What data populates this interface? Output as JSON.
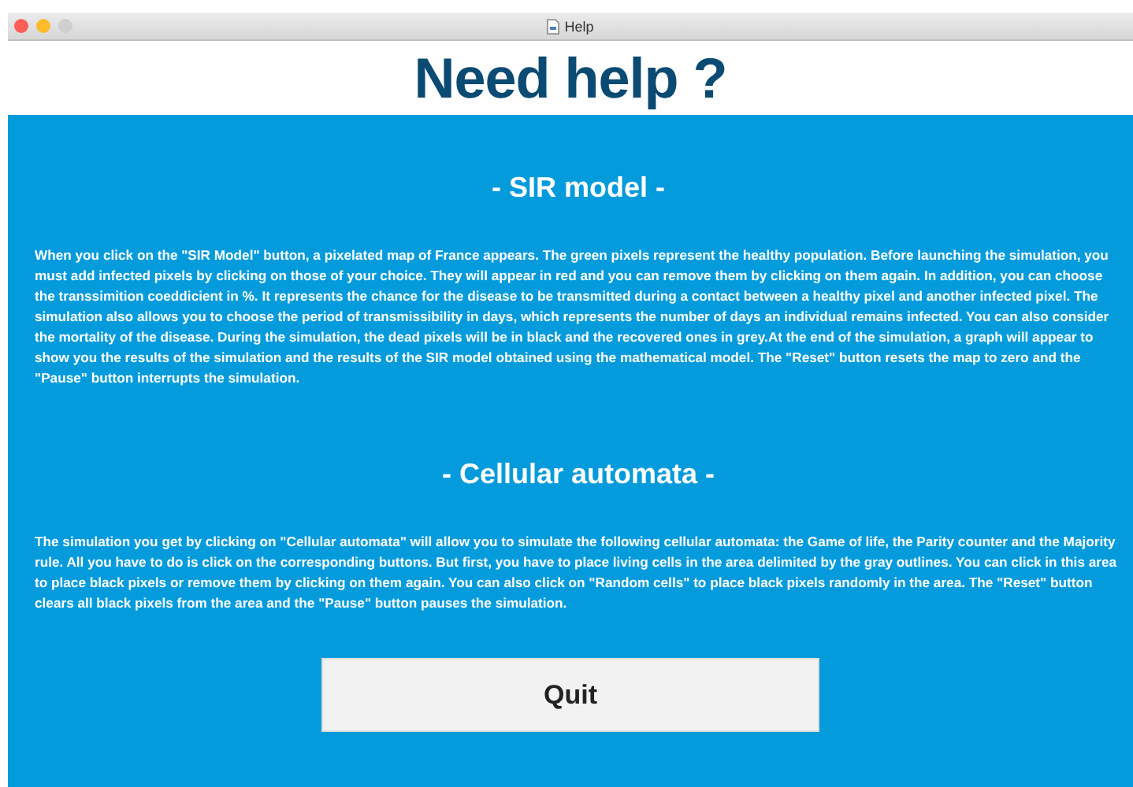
{
  "window": {
    "title": "Help"
  },
  "heading": "Need help ?",
  "sections": [
    {
      "title": "- SIR model -",
      "body": "When you click on the \"SIR Model\" button, a pixelated map of France appears. The green pixels represent the healthy population. Before launching the simulation, you must add infected pixels by clicking on those of your choice. They will appear in red and you can remove them by clicking on them again. In addition, you can choose the transsimition coeddicient in %. It represents the chance for the disease to be transmitted during a contact between a healthy pixel and another infected pixel. The simulation also allows you to choose the period of transmissibility in days, which represents the number of days an individual remains infected. You can also consider the mortality of the disease. During the simulation, the dead pixels will be in black and the recovered ones in grey.At the end of the simulation, a graph will appear to show you the results of the simulation and the results of the SIR model obtained using the mathematical model. The \"Reset\" button resets the map to zero and the \"Pause\" button interrupts the simulation."
    },
    {
      "title": "- Cellular automata -",
      "body": "The simulation you get by clicking on \"Cellular automata\" will allow you to simulate the following cellular automata: the Game of life, the Parity counter and the Majority rule. All you have to do is click on the corresponding buttons. But first, you have to place living cells in the area delimited by the gray outlines. You can click in this area to place black pixels or remove them by clicking on them again. You can also click on \"Random cells\" to place black pixels randomly in the area. The \"Reset\" button clears all black pixels from the area and the \"Pause\" button pauses the simulation."
    }
  ],
  "button": {
    "label": "Quit"
  }
}
